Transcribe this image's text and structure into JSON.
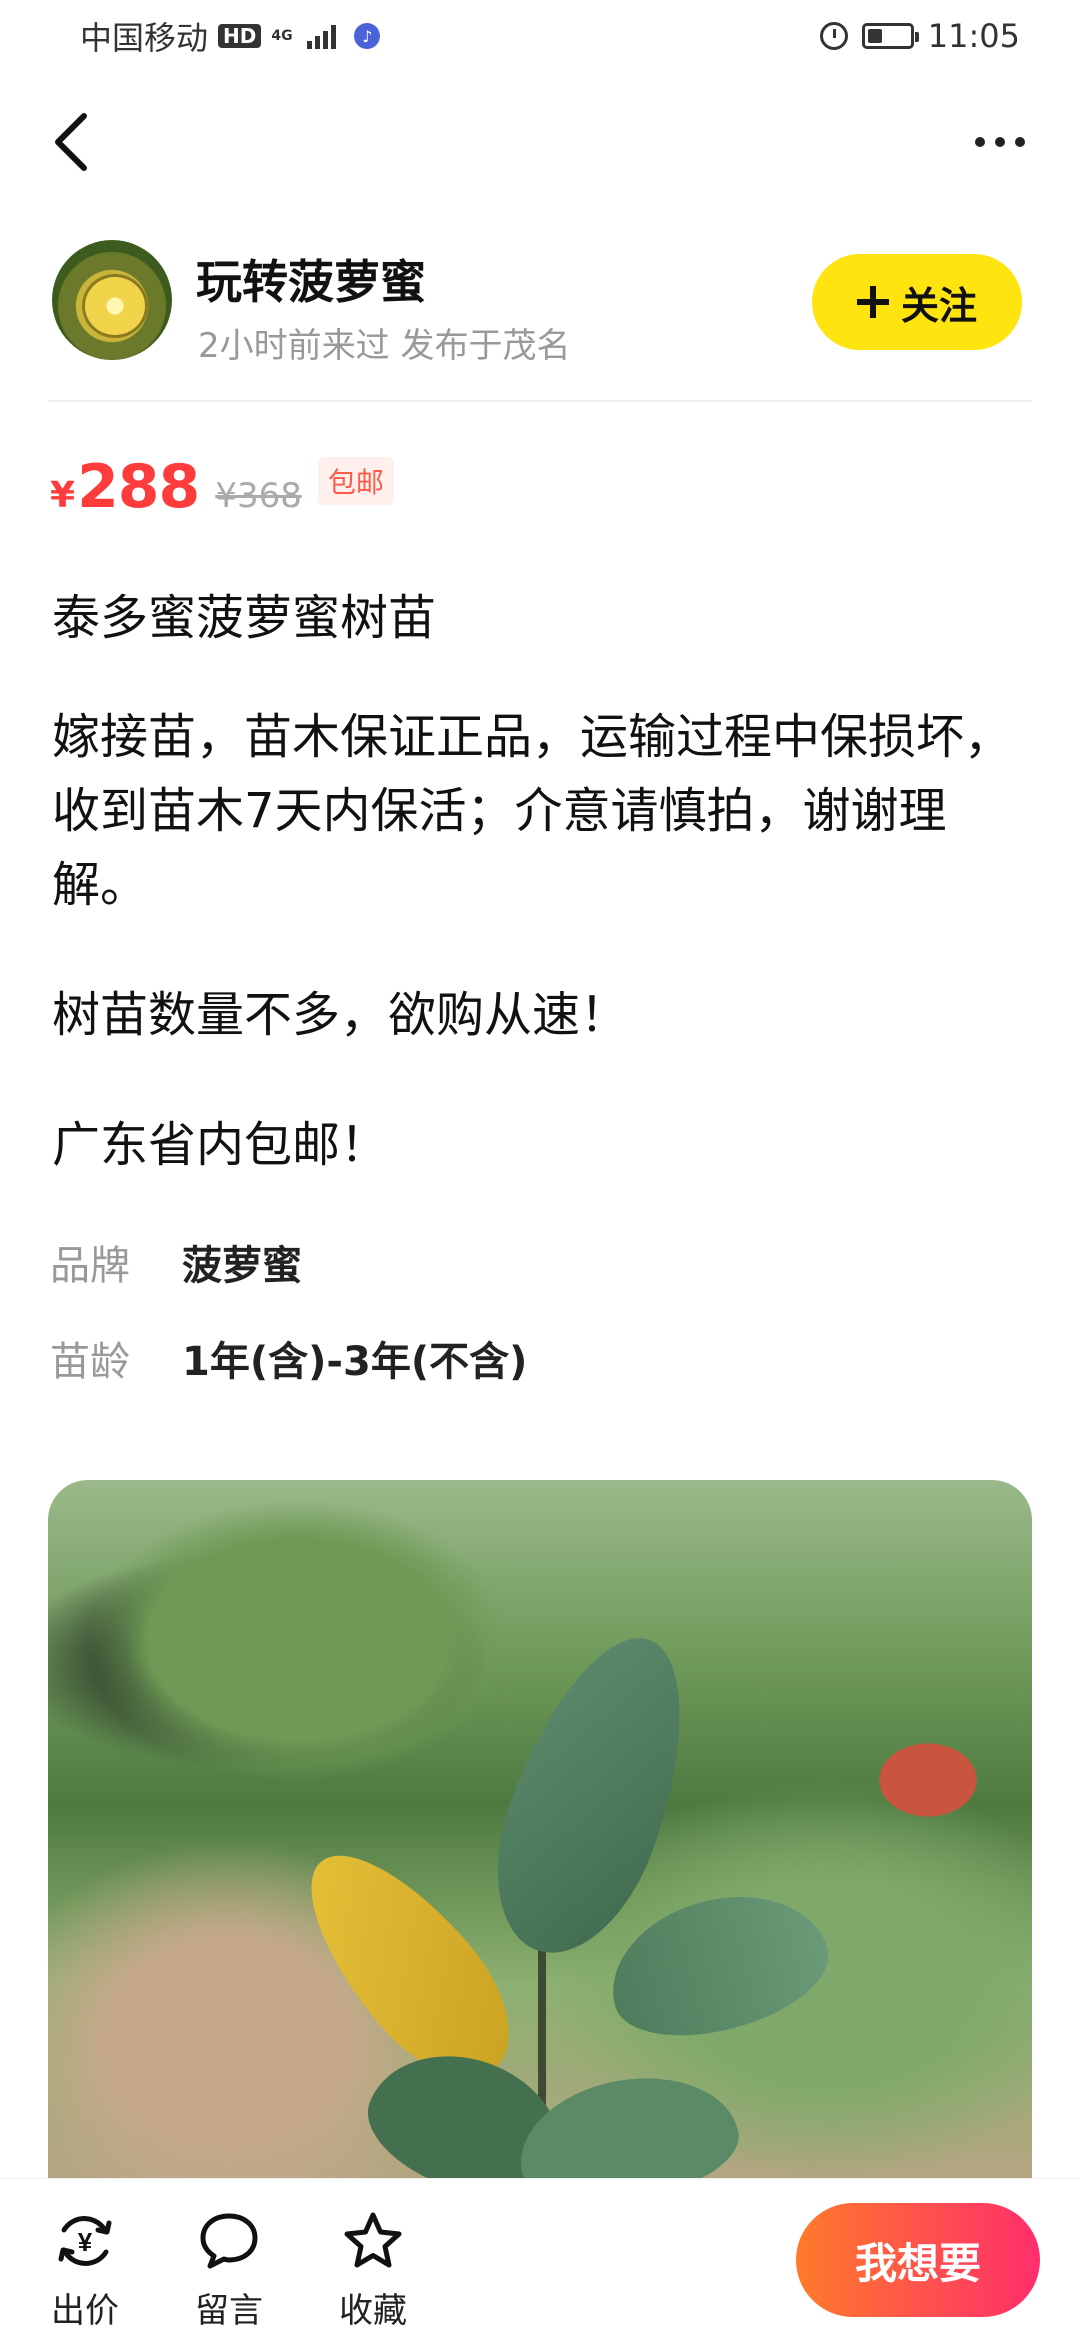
{
  "status_bar": {
    "carrier": "中国移动",
    "hd": "HD",
    "network": "4G",
    "time": "11:05"
  },
  "icons": {
    "back": "chevron-left-icon",
    "more": "more-dots-icon",
    "follow": "plus-icon",
    "bid": "yen-exchange-icon",
    "message": "chat-bubble-icon",
    "favorite": "star-icon"
  },
  "seller": {
    "name": "玩转菠萝蜜",
    "meta": "2小时前来过 发布于茂名",
    "follow_label": "关注"
  },
  "price": {
    "currency": "¥",
    "current": "288",
    "original": "¥368",
    "shipping_badge": "包邮"
  },
  "product": {
    "title": "泰多蜜菠萝蜜树苗",
    "description": [
      "嫁接苗，苗木保证正品，运输过程中保损坏，收到苗木7天内保活；介意请慎拍，谢谢理解。",
      "树苗数量不多，欲购从速！",
      "广东省内包邮！"
    ],
    "attributes": [
      {
        "key": "品牌",
        "value": "菠萝蜜"
      },
      {
        "key": "苗龄",
        "value": "1年(含)-3年(不含)"
      }
    ]
  },
  "bottom_bar": {
    "bid_label": "出价",
    "message_label": "留言",
    "favorite_label": "收藏",
    "want_label": "我想要"
  },
  "colors": {
    "accent_yellow": "#ffe40f",
    "price_red": "#ff3c3c",
    "cta_gradient_start": "#ff7a2a",
    "cta_gradient_end": "#ff2e6c"
  }
}
